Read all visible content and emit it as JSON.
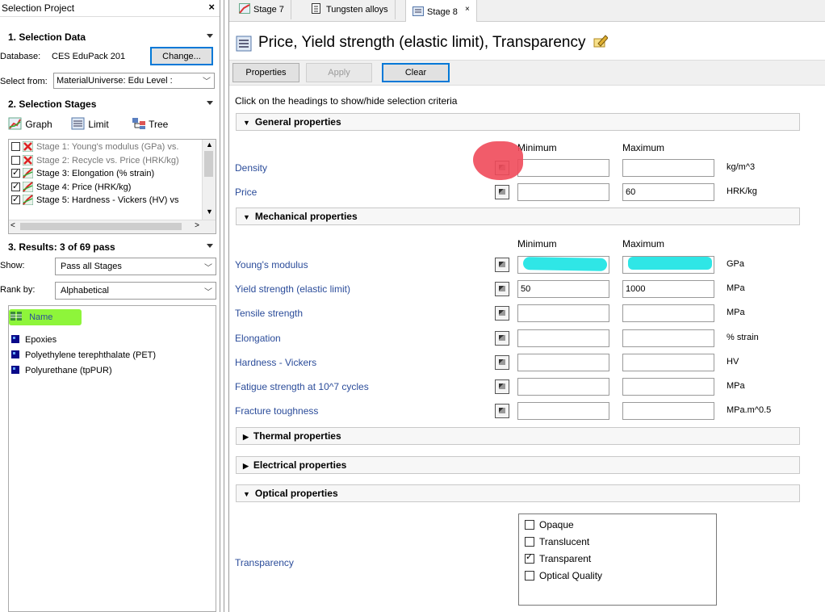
{
  "left": {
    "title": "Selection Project",
    "close": "×",
    "selection_data": {
      "header": "1. Selection Data",
      "database_label": "Database:",
      "database_value": "CES EduPack 201",
      "change_button": "Change...",
      "select_from_label": "Select from:",
      "select_from_value": "MaterialUniverse: Edu Level :"
    },
    "stages": {
      "header": "2. Selection Stages",
      "graph_label": "Graph",
      "limit_label": "Limit",
      "tree_label": "Tree",
      "items": [
        {
          "label": "Stage 1: Young's modulus (GPa) vs.",
          "checked": false,
          "icon": "stage-graph-failed-icon",
          "grey": true
        },
        {
          "label": "Stage 2: Recycle vs. Price (HRK/kg)",
          "checked": false,
          "icon": "stage-graph-failed-icon",
          "grey": true
        },
        {
          "label": "Stage 3: Elongation (% strain)",
          "checked": true,
          "icon": "stage-graph-icon",
          "grey": false
        },
        {
          "label": "Stage 4: Price (HRK/kg)",
          "checked": true,
          "icon": "stage-graph-icon",
          "grey": false
        },
        {
          "label": "Stage 5: Hardness - Vickers (HV) vs",
          "checked": true,
          "icon": "stage-graph-icon",
          "grey": false
        }
      ]
    },
    "results": {
      "header": "3. Results: 3 of 69 pass",
      "show_label": "Show:",
      "show_value": "Pass all Stages",
      "rank_label": "Rank by:",
      "rank_value": "Alphabetical",
      "name_column": "Name",
      "items": [
        "Epoxies",
        "Polyethylene terephthalate (PET)",
        "Polyurethane (tpPUR)"
      ]
    }
  },
  "tabs": [
    {
      "label": "Stage 7",
      "icon": "graph-icon"
    },
    {
      "label": "Tungsten alloys",
      "icon": "document-icon"
    },
    {
      "label": "Stage 8",
      "icon": "limit-icon",
      "close": "×"
    }
  ],
  "page": {
    "title": "Price, Yield strength (elastic limit), Transparency",
    "toolbar": {
      "properties": "Properties",
      "apply": "Apply",
      "clear": "Clear"
    },
    "instruction": "Click on the headings to show/hide selection criteria",
    "min_label": "Minimum",
    "max_label": "Maximum"
  },
  "groups": {
    "general": {
      "header": "General properties",
      "rows": [
        {
          "label": "Density",
          "min": "",
          "max": "",
          "unit": "kg/m^3"
        },
        {
          "label": "Price",
          "min": "",
          "max": "60",
          "unit": "HRK/kg"
        }
      ]
    },
    "mechanical": {
      "header": "Mechanical properties",
      "rows": [
        {
          "label": "Young's modulus",
          "min": "",
          "max": "",
          "unit": "GPa"
        },
        {
          "label": "Yield strength (elastic limit)",
          "min": "50",
          "max": "1000",
          "unit": "MPa"
        },
        {
          "label": "Tensile strength",
          "min": "",
          "max": "",
          "unit": "MPa"
        },
        {
          "label": "Elongation",
          "min": "",
          "max": "",
          "unit": "% strain"
        },
        {
          "label": "Hardness - Vickers",
          "min": "",
          "max": "",
          "unit": "HV"
        },
        {
          "label": "Fatigue strength at 10^7 cycles",
          "min": "",
          "max": "",
          "unit": "MPa"
        },
        {
          "label": "Fracture toughness",
          "min": "",
          "max": "",
          "unit": "MPa.m^0.5"
        }
      ]
    },
    "thermal": {
      "header": "Thermal properties"
    },
    "electrical": {
      "header": "Electrical properties"
    },
    "optical": {
      "header": "Optical properties",
      "transparency_label": "Transparency",
      "options": [
        {
          "label": "Opaque",
          "checked": false
        },
        {
          "label": "Translucent",
          "checked": false
        },
        {
          "label": "Transparent",
          "checked": true
        },
        {
          "label": "Optical Quality",
          "checked": false
        }
      ]
    }
  },
  "colors": {
    "label_blue": "#2b4c9a",
    "highlight_red": "#f04a5a",
    "highlight_cyan": "#2fe6e6",
    "highlight_green": "#8ef53a",
    "focus_blue": "#0078d7"
  }
}
